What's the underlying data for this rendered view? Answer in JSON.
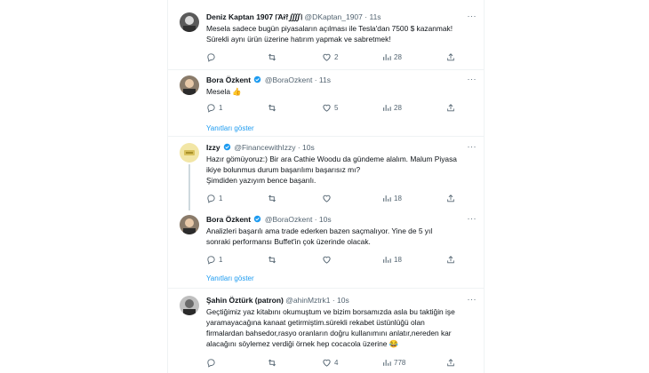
{
  "tweets": [
    {
      "name": "Deniz Kaptan 1907 ⧙Ἂɨ⫯⨌⧙",
      "handle": "@DKaptan_1907",
      "time": "11s",
      "lines": [
        "Mesela sadece bugün piyasaların açılması ile Tesla'dan 7500 $ kazanmak!",
        "Sürekli aynı ürün üzerine hatırım yapmak ve sabretmek!"
      ],
      "replies": "",
      "retweets": "",
      "likes": "2",
      "views": "28",
      "avatar_color": "#4a4a4a"
    },
    {
      "name": "Bora Özkent",
      "handle": "@BoraOzkent",
      "time": "11s",
      "lines": [
        "Mesela 👍"
      ],
      "replies": "1",
      "retweets": "",
      "likes": "5",
      "views": "28",
      "avatar_color": "#6b5a4a"
    },
    {
      "name": "Izzy",
      "handle": "@FinancewithIzzy",
      "time": "10s",
      "lines": [
        "Hazır gömüyoruz:) Bir ara Cathie Woodu da gündeme alalım. Malum Piyasa",
        "ikiye bolunmus durum başarılımı başarısız mı?",
        "Şimdiden yazıyım bence başarılı."
      ],
      "replies": "1",
      "retweets": "",
      "likes": "",
      "views": "18",
      "avatar_color": "#f3e7a8"
    },
    {
      "name": "Bora Özkent",
      "handle": "@BoraOzkent",
      "time": "10s",
      "lines": [
        "Analizleri başarılı ama trade ederken bazen saçmalıyor. Yine de 5 yıl",
        "sonraki performansı Buffet'in çok üzerinde olacak."
      ],
      "replies": "1",
      "retweets": "",
      "likes": "",
      "views": "18",
      "avatar_color": "#6b5a4a"
    },
    {
      "name": "Şahin Öztürk (patron)",
      "handle": "@ahinMztrk1",
      "time": "10s",
      "lines": [
        "Geçtiğimiz yaz kitabını okumuştum ve bizim borsamızda asla bu taktiğin işe",
        "yaramayacağına kanaat getirmiştim.sürekli rekabet üstünlüğü olan",
        "firmalardan bahsedor,rasyo oranların doğru kullanımını anlatır,nereden kar",
        "alacağını söylemez verdiği örnek hep cocacola üzerine 😂"
      ],
      "replies": "",
      "retweets": "",
      "likes": "4",
      "views": "778",
      "avatar_color": "#3a3a3a"
    }
  ],
  "show_replies_label": "Yanıtları göster",
  "more_label": "···",
  "colors": {
    "accent": "#1d9bf0",
    "muted": "#536471",
    "border": "#eff3f4",
    "verified": "#1d9bf0"
  }
}
